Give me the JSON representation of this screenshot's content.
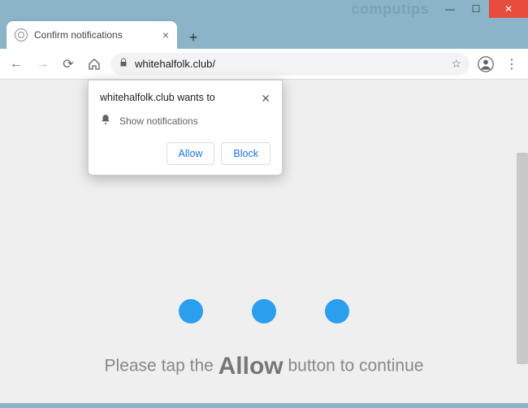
{
  "watermark": "computips",
  "window": {
    "minimize": "—",
    "maximize": "☐",
    "close": "✕"
  },
  "tab": {
    "title": "Confirm notifications",
    "close": "×",
    "new": "+"
  },
  "toolbar": {
    "back": "←",
    "forward": "→",
    "reload": "⟳",
    "home": "⌂",
    "lock": "🔒",
    "url": "whitehalfolk.club/",
    "star": "☆",
    "profile": "👤",
    "menu": "⋮"
  },
  "permission": {
    "title": "whitehalfolk.club wants to",
    "close": "✕",
    "bell": "🔔",
    "label": "Show notifications",
    "allow": "Allow",
    "block": "Block"
  },
  "page": {
    "msg_pre": "Please tap the ",
    "msg_bold": "Allow",
    "msg_post": " button to continue"
  }
}
